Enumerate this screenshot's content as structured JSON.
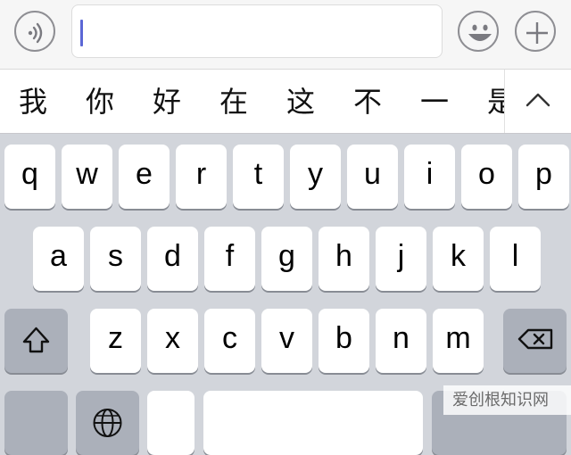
{
  "input_bar": {
    "voice_icon": "voice-wave-icon",
    "emoji_icon": "smiley-icon",
    "add_icon": "plus-icon",
    "message_value": "",
    "caret_color": "#5b67d6"
  },
  "candidates": [
    "我",
    "你",
    "好",
    "在",
    "这",
    "不",
    "一",
    "是"
  ],
  "expand_icon": "chevron-up-icon",
  "keyboard": {
    "row1": [
      "q",
      "w",
      "e",
      "r",
      "t",
      "y",
      "u",
      "i",
      "o",
      "p"
    ],
    "row2": [
      "a",
      "s",
      "d",
      "f",
      "g",
      "h",
      "j",
      "k",
      "l"
    ],
    "row3": [
      "z",
      "x",
      "c",
      "v",
      "b",
      "n",
      "m"
    ],
    "shift_icon": "shift-arrow-icon",
    "delete_icon": "backspace-icon",
    "globe_icon": "globe-icon"
  },
  "watermark": "爱创根知识网",
  "colors": {
    "keyboard_bg": "#d2d5db",
    "key_bg": "#ffffff",
    "function_key_bg": "#abb0ba"
  }
}
